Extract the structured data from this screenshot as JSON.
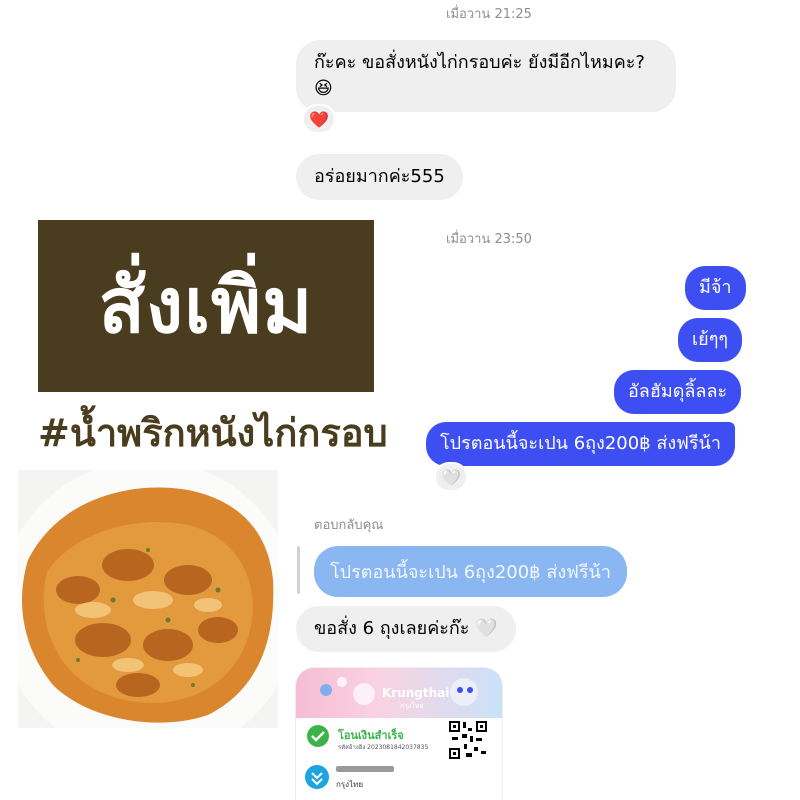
{
  "timestamps": {
    "first": "เมื่อวาน 21:25",
    "second": "เมื่อวาน 23:50"
  },
  "incoming": {
    "msg1_line1": "ก๊ะคะ ขอสั่งหนังไก่กรอบค่ะ ยังมีอีกไหมคะ?",
    "msg1_emoji": "😆",
    "msg1_reaction": "❤️",
    "msg2": "อร่อยมากค่ะ555",
    "msg3": "ขอสั่ง 6 ถุงเลยค่ะก๊ะ 🤍"
  },
  "outgoing": {
    "msg1": "มีจ้า",
    "msg2": "เย้ๆๆ",
    "msg3": "อัลฮัมดุลิ้ลละ",
    "msg4": "โปรตอนนี้จะเปน 6ถุง200฿ ส่งฟรีน้า",
    "msg4_reaction": "🤍"
  },
  "reply": {
    "label": "ตอบกลับคุณ",
    "quote": "โปรตอนนี้จะเปน 6ถุง200฿ ส่งฟรีน้า"
  },
  "overlay": {
    "banner_title": "สั่งเพิ่ม",
    "hashtag": "#น้ำพริกหนังไก่กรอบ"
  },
  "slip": {
    "brand": "Krungthai",
    "brand_sub": "กรุงไทย",
    "status": "โอนเงินสำเร็จ",
    "ref": "รหัสอ้างอิง 2023081842037835",
    "bank": "กรุงไทย"
  },
  "colors": {
    "outgoing_bubble": "#3d4ef2",
    "incoming_bubble": "#efefef",
    "banner_bg": "#4a3d1f",
    "reply_quote_bg": "#8ab6f2",
    "success_green": "#3cb34a"
  }
}
